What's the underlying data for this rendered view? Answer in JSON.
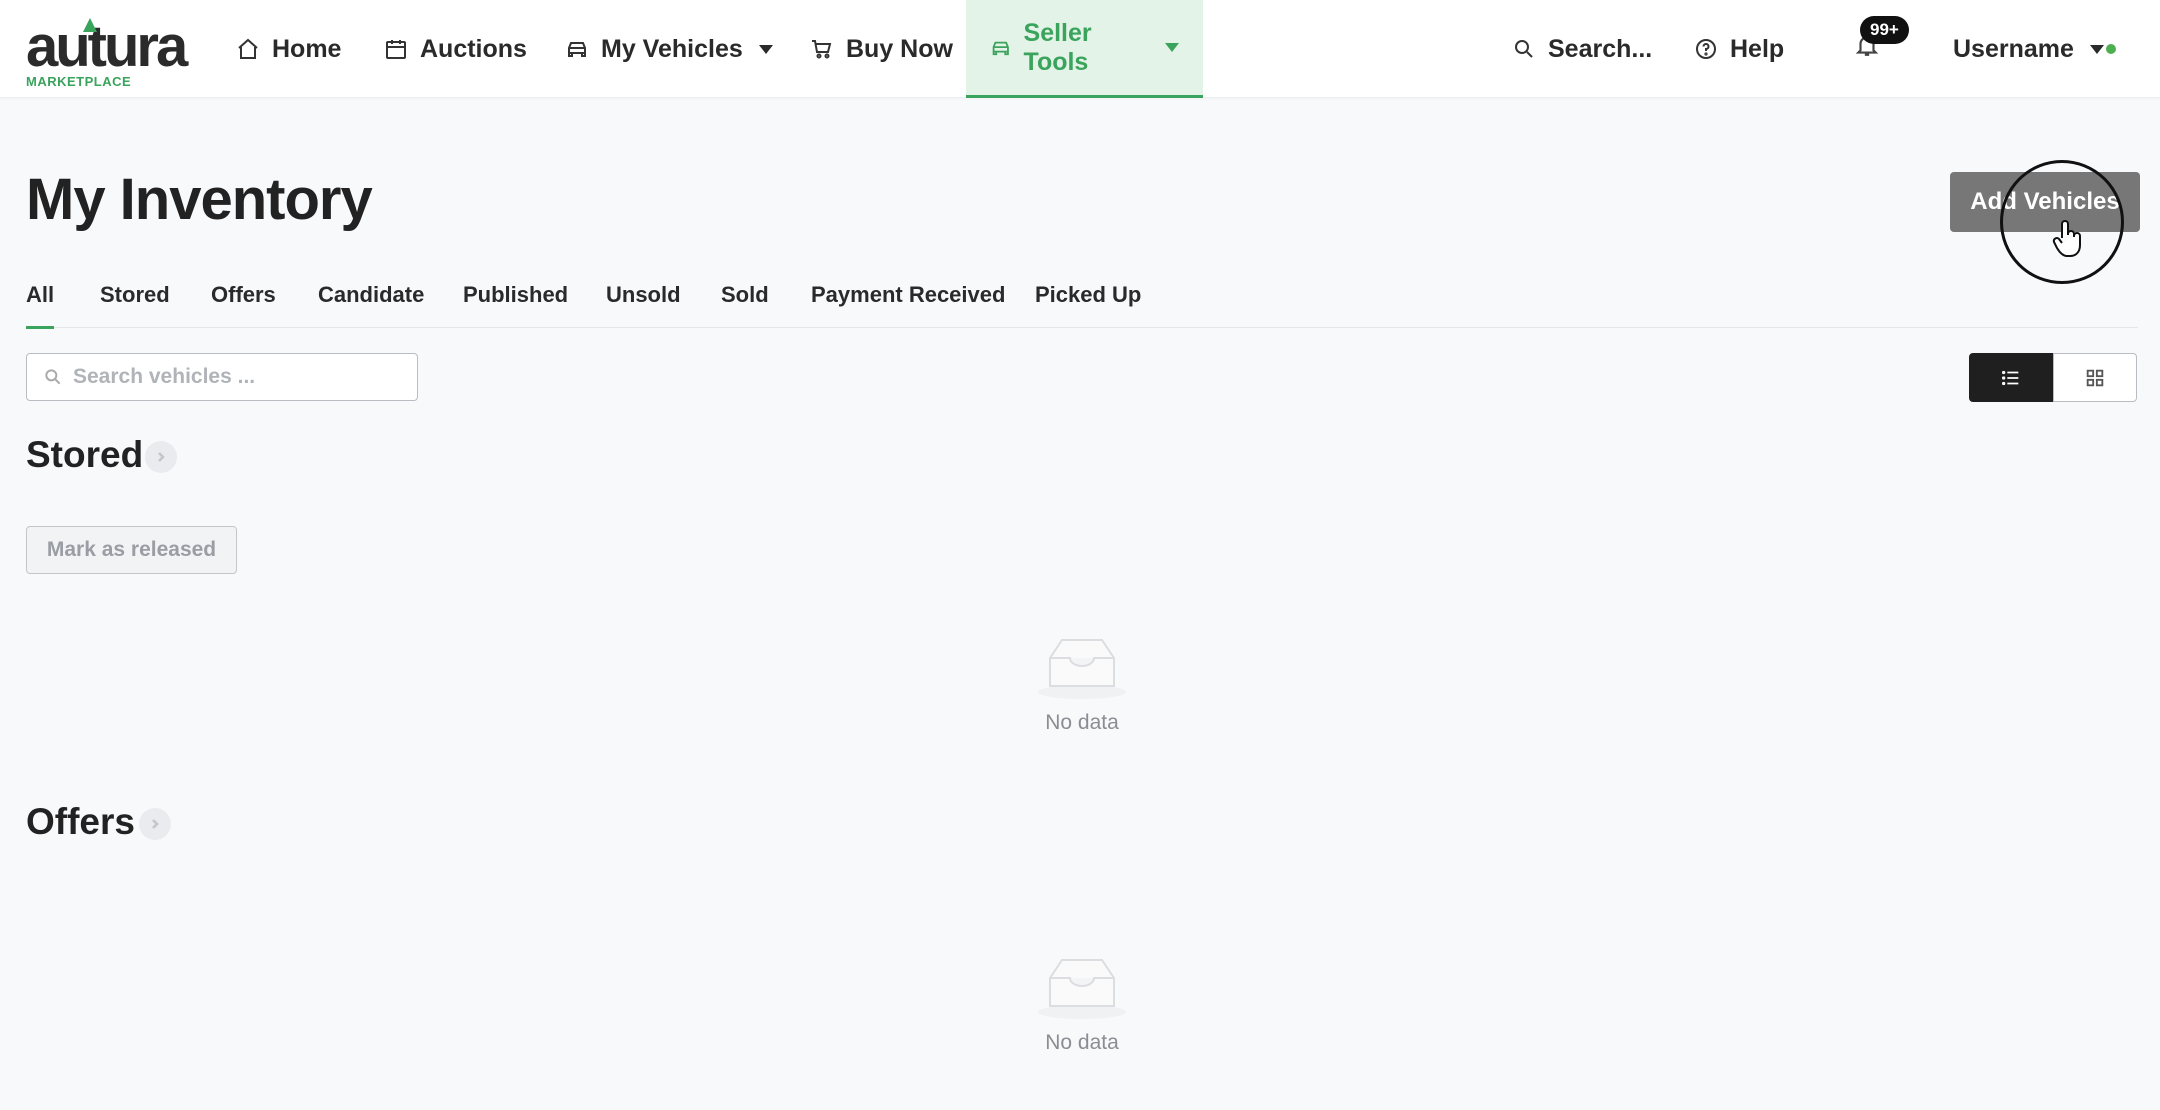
{
  "brand": {
    "name": "autura",
    "sub": "MARKETPLACE"
  },
  "nav": {
    "home": "Home",
    "auctions": "Auctions",
    "my_vehicles": "My Vehicles",
    "buy_now": "Buy Now",
    "seller_tools": "Seller Tools",
    "search": "Search...",
    "help": "Help",
    "notifications_badge": "99+",
    "username": "Username"
  },
  "page": {
    "title": "My Inventory",
    "add_button": "Add Vehicles"
  },
  "tabs": [
    {
      "label": "All",
      "active": true
    },
    {
      "label": "Stored"
    },
    {
      "label": "Offers"
    },
    {
      "label": "Candidate"
    },
    {
      "label": "Published"
    },
    {
      "label": "Unsold"
    },
    {
      "label": "Sold"
    },
    {
      "label": "Payment Received"
    },
    {
      "label": "Picked Up"
    }
  ],
  "search": {
    "placeholder": "Search vehicles ...",
    "value": ""
  },
  "view_modes": {
    "selected": "list"
  },
  "sections": {
    "stored": {
      "title": "Stored",
      "action": "Mark as released",
      "empty": "No data"
    },
    "offers": {
      "title": "Offers",
      "empty": "No data"
    }
  },
  "colors": {
    "accent": "#3aa35c",
    "active_nav_bg": "#e4f3e8",
    "primary_button": "#777777"
  }
}
